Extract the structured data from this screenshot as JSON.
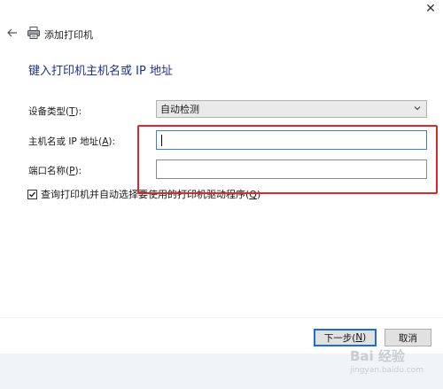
{
  "window": {
    "close_glyph": "✕",
    "title": "添加打印机"
  },
  "page": {
    "heading": "键入打印机主机名或 IP 地址"
  },
  "form": {
    "device_type": {
      "label_prefix": "设备类型(",
      "label_key": "T",
      "label_suffix": "):",
      "value": "自动检测"
    },
    "host": {
      "label_prefix": "主机名或 IP 地址(",
      "label_key": "A",
      "label_suffix": "):",
      "value": ""
    },
    "port": {
      "label_prefix": "端口名称(",
      "label_key": "P",
      "label_suffix": "):",
      "value": ""
    },
    "query_driver": {
      "checked": true,
      "label_prefix": "查询打印机并自动选择要使用的打印机驱动程序(",
      "label_key": "Q",
      "label_suffix": ")"
    }
  },
  "buttons": {
    "next_prefix": "下一步(",
    "next_key": "N",
    "next_suffix": ")",
    "cancel": "取消"
  },
  "icons": {
    "back": "arrow-left-icon",
    "printer": "printer-icon",
    "chevron": "chevron-down-icon",
    "check": "checkmark-icon"
  },
  "colors": {
    "heading": "#1e3287",
    "focus_border": "#3a80d0",
    "highlight": "#e0282a",
    "primary_border": "#1b6fd1"
  },
  "watermark": {
    "brand": "Bai  经验",
    "sub": "jingyan.baidu.com"
  }
}
